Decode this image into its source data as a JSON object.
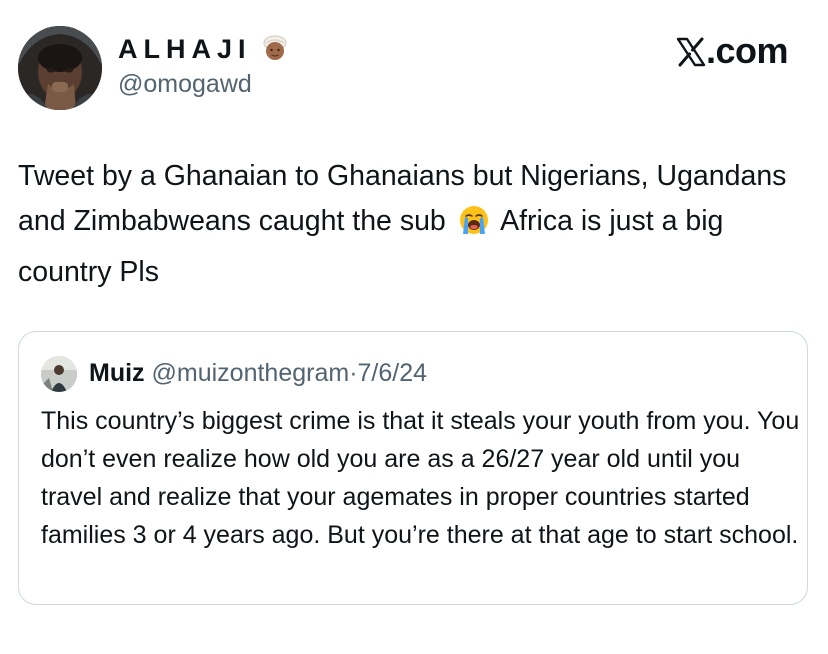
{
  "author": {
    "display_name": "ALHAJI",
    "handle": "@omogawd"
  },
  "site": {
    "label": ".com"
  },
  "tweet": {
    "text_part1": "Tweet by a Ghanaian to Ghanaians but Nigerians, Ugandans and Zimbabweans caught the sub",
    "text_part2": "Africa is just a big country Pls"
  },
  "quoted": {
    "name": "Muiz",
    "handle": "@muizonthegram",
    "separator": "·",
    "date": "7/6/24",
    "text": "This country’s biggest crime is that it steals your youth from you. You don’t even realize how old you are as a 26/27 year old until you travel and realize that your agemates in proper countries started families 3 or 4 years ago. But you’re there at that age to start school."
  },
  "icons": {
    "name_emoji": "person-with-turban-emoji",
    "sob_emoji": "loudly-crying-face-emoji",
    "site_logo": "x-logo-icon"
  },
  "colors": {
    "text_primary": "#0f1419",
    "text_secondary": "#536471",
    "border": "#cfd9de",
    "background": "#ffffff"
  }
}
